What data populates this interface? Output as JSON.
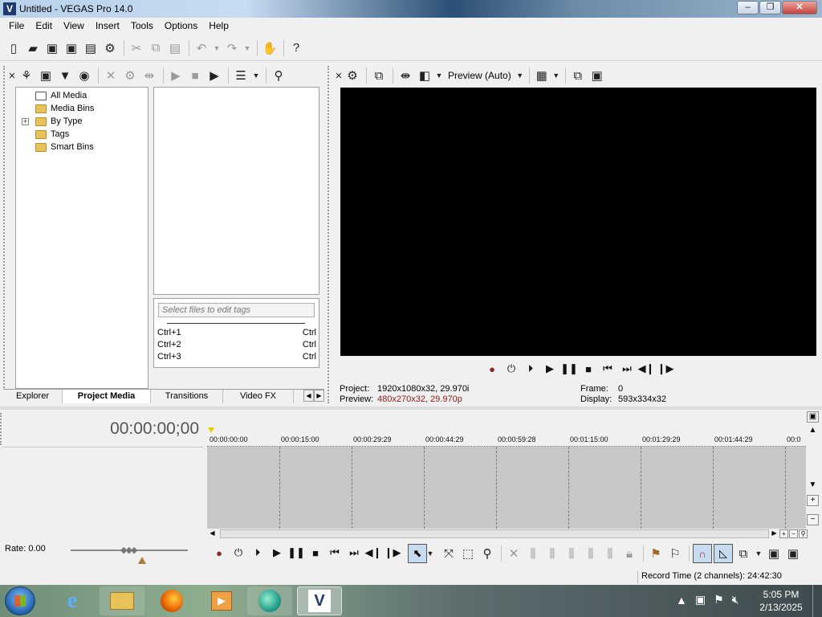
{
  "window": {
    "app_icon": "vegas-logo-icon",
    "title": "Untitled - VEGAS Pro 14.0",
    "controls": [
      "–",
      "❐",
      "✕"
    ]
  },
  "menu": [
    "File",
    "Edit",
    "View",
    "Insert",
    "Tools",
    "Options",
    "Help"
  ],
  "left_panel": {
    "tree": [
      "All Media",
      "Media Bins",
      "By Type",
      "Tags",
      "Smart Bins"
    ],
    "tags_placeholder": "Select files to edit tags",
    "shortcuts": [
      {
        "key": "Ctrl+1",
        "label": "Ctrl"
      },
      {
        "key": "Ctrl+2",
        "label": "Ctrl"
      },
      {
        "key": "Ctrl+3",
        "label": "Ctrl"
      }
    ],
    "tabs": [
      "Explorer",
      "Project Media",
      "Transitions",
      "Video FX"
    ],
    "active_tab": "Project Media"
  },
  "preview": {
    "quality_label": "Preview (Auto)",
    "project_label": "Project:",
    "project_value": "1920x1080x32, 29.970i",
    "preview_label": "Preview:",
    "preview_value": "480x270x32, 29.970p",
    "frame_label": "Frame:",
    "frame_value": "0",
    "display_label": "Display:",
    "display_value": "593x334x32",
    "accent_color": "#8b1a1a"
  },
  "timeline": {
    "timecode": "00:00:00;00",
    "ruler_labels": [
      "00:00:00:00",
      "00:00:15:00",
      "00:00:29:29",
      "00:00:44:29",
      "00:00:59:28",
      "00:01:15:00",
      "00:01:29:29",
      "00:01:44:29",
      "00:0"
    ]
  },
  "bottom": {
    "rate_label": "Rate: 0.00"
  },
  "status": {
    "record_time": "Record Time (2 channels): 24:42:30"
  },
  "taskbar": {
    "apps": [
      "internet-explorer-icon",
      "file-explorer-icon",
      "firefox-icon",
      "media-player-icon",
      "browser-icon",
      "vegas-pro-icon"
    ],
    "time": "5:05 PM",
    "date": "2/13/2025"
  }
}
